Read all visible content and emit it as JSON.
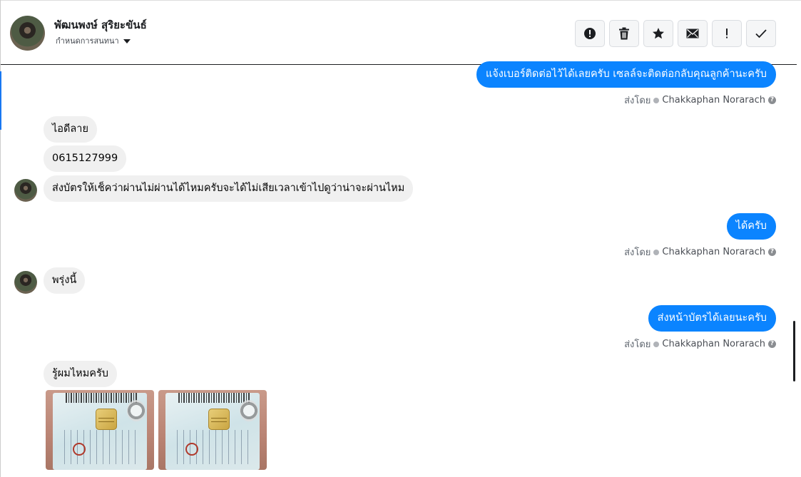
{
  "header": {
    "contact_name": "พัฒนพงษ์ สุริยะขันธ์",
    "assign_label": "กำหนดการสนทนา",
    "toolbar": [
      {
        "name": "mark-spam-button",
        "icon": "alert-circle-icon"
      },
      {
        "name": "delete-button",
        "icon": "trash-icon"
      },
      {
        "name": "star-button",
        "icon": "star-icon"
      },
      {
        "name": "mark-unread-button",
        "icon": "envelope-icon"
      },
      {
        "name": "follow-up-button",
        "icon": "exclamation-icon"
      },
      {
        "name": "mark-done-button",
        "icon": "checkmark-icon"
      }
    ]
  },
  "sent_by_label": "ส่งโดย",
  "agent_name": "Chakkaphan Norarach",
  "messages": {
    "m1": "แจ้งเบอร์ติดต่อไว้ได้เลยครับ เซลล์จะติดต่อกลับคุณลูกค้านะครับ",
    "m2": "ไอดีลาย",
    "m3": "0615127999",
    "m4": "ส่งบัตรให้เช็คว่าผ่านไม่ผ่านได้ไหมครับจะได้ไม่เสียเวลาเข้าไปดูว่าน่าจะผ่านไหม",
    "m5": "ได้ครับ",
    "m6": "พรุ่งนี้",
    "m7": "ส่งหน้าบัตรได้เลยนะครับ",
    "m8": "รู้ผมไหมครับ"
  },
  "colors": {
    "outgoing_bubble": "#0b84ff",
    "incoming_bubble": "#f0f0f0",
    "accent": "#1877f2"
  }
}
